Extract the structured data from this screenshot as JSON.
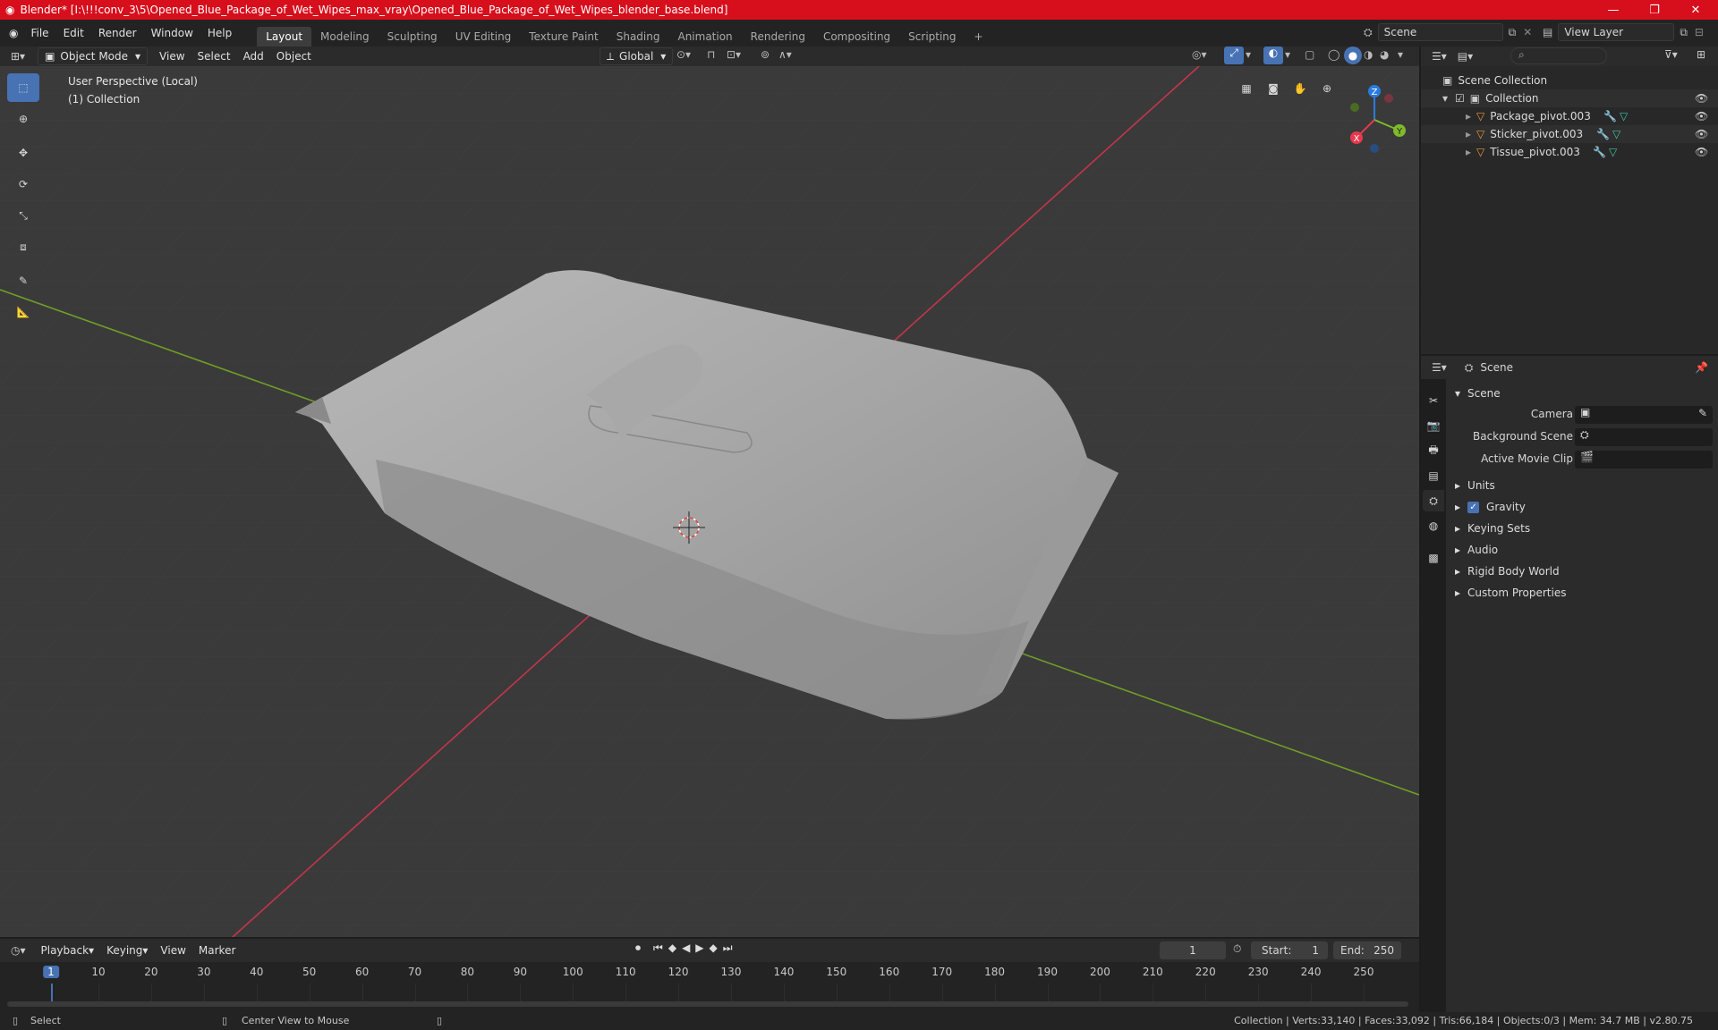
{
  "window": {
    "title": "Blender* [I:\\!!!conv_3\\5\\Opened_Blue_Package_of_Wet_Wipes_max_vray\\Opened_Blue_Package_of_Wet_Wipes_blender_base.blend]",
    "minimize": "—",
    "maximize": "❐",
    "close": "✕"
  },
  "menu": [
    "File",
    "Edit",
    "Render",
    "Window",
    "Help"
  ],
  "workspaces": [
    "Layout",
    "Modeling",
    "Sculpting",
    "UV Editing",
    "Texture Paint",
    "Shading",
    "Animation",
    "Rendering",
    "Compositing",
    "Scripting"
  ],
  "add_workspace": "+",
  "scene_name": "Scene",
  "view_layer": "View Layer",
  "viewport_header": {
    "mode": "Object Mode",
    "menus": [
      "View",
      "Select",
      "Add",
      "Object"
    ],
    "transform": "Global"
  },
  "viewport": {
    "perspective": "User Perspective (Local)",
    "collection": "(1) Collection",
    "gizmo": {
      "z": "Z",
      "y": "Y",
      "x": "X"
    }
  },
  "outliner": {
    "root": "Scene Collection",
    "collection": "Collection",
    "objects": [
      "Package_pivot.003",
      "Sticker_pivot.003",
      "Tissue_pivot.003"
    ]
  },
  "properties": {
    "header": "Scene",
    "panel": "Scene",
    "fields": [
      {
        "label": "Camera"
      },
      {
        "label": "Background Scene"
      },
      {
        "label": "Active Movie Clip"
      }
    ],
    "sections": [
      "Units",
      "Gravity",
      "Keying Sets",
      "Audio",
      "Rigid Body World",
      "Custom Properties"
    ]
  },
  "timeline": {
    "menus": [
      "Playback",
      "Keying",
      "View",
      "Marker"
    ],
    "current_frame": "1",
    "start_label": "Start:",
    "start": "1",
    "end_label": "End:",
    "end": "250",
    "ticks": [
      "1",
      "10",
      "20",
      "30",
      "40",
      "50",
      "60",
      "70",
      "80",
      "90",
      "100",
      "110",
      "120",
      "130",
      "140",
      "150",
      "160",
      "170",
      "180",
      "190",
      "200",
      "210",
      "220",
      "230",
      "240",
      "250"
    ]
  },
  "status": {
    "left1": "Select",
    "left2": "Center View to Mouse",
    "right": "Collection | Verts:33,140 | Faces:33,092 | Tris:66,184 | Objects:0/3 | Mem: 34.7 MB | v2.80.75"
  },
  "colors": {
    "title_bar": "#d70e1c",
    "accent": "#4772b3",
    "x_axis": "#e8384d",
    "y_axis": "#7fba2b",
    "z_axis": "#2a7be0",
    "object_icon": "#e89a3c"
  }
}
